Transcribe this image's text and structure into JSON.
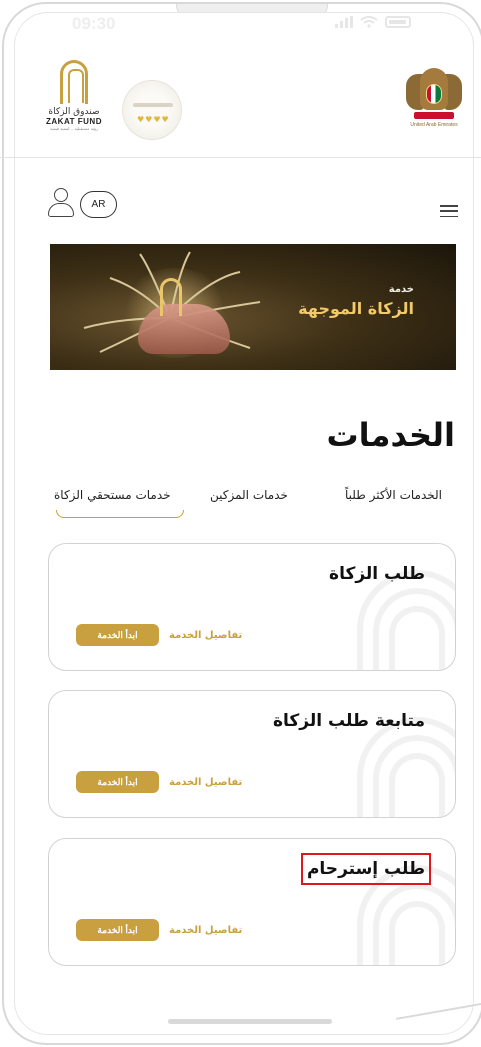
{
  "status_bar": {
    "time": "09:30"
  },
  "header": {
    "zakat_logo": {
      "name_ar": "صندوق الزكاة",
      "name_en": "ZAKAT FUND",
      "tagline": "رؤية مستقبلية .. لتنمية قيمية"
    },
    "uae_emblem": {
      "caption": "United Arab Emirates"
    }
  },
  "toolbar": {
    "lang_label": "AR"
  },
  "banner": {
    "kicker": "خدمة",
    "title": "الزكاة الموجهة"
  },
  "page": {
    "title": "الخدمات"
  },
  "tabs": [
    {
      "label": "الخدمات الأكثر طلباً",
      "active": false
    },
    {
      "label": "خدمات المزكين",
      "active": false
    },
    {
      "label": "خدمات مستحقي الزكاة",
      "active": true
    }
  ],
  "cards": [
    {
      "title": "طلب الزكاة",
      "details_label": "تفاصيل الخدمة",
      "start_label": "ابدأ الخدمة",
      "highlighted": false
    },
    {
      "title": "متابعة طلب الزكاة",
      "details_label": "تفاصيل الخدمة",
      "start_label": "ابدأ الخدمة",
      "highlighted": false
    },
    {
      "title": "طلب إسترحام",
      "details_label": "تفاصيل الخدمة",
      "start_label": "ابدأ الخدمة",
      "highlighted": true
    }
  ],
  "colors": {
    "accent": "#c9a03f",
    "highlight_box": "#e0161e",
    "text": "#111111"
  },
  "icons": [
    "signal-icon",
    "wifi-icon",
    "battery-icon",
    "profile-icon",
    "menu-icon"
  ]
}
